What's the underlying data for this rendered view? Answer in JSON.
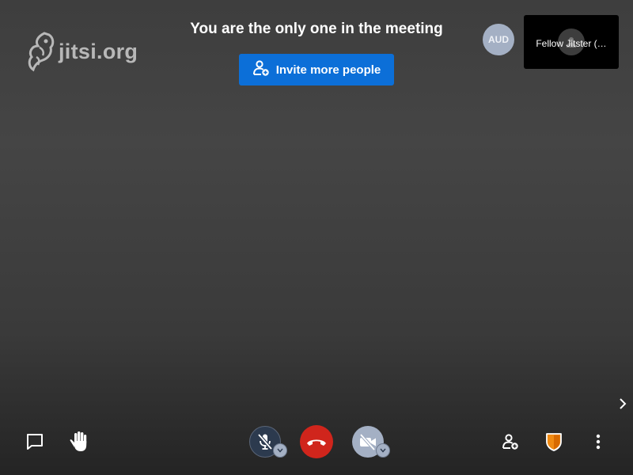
{
  "branding": {
    "logo_text": "jitsi.org",
    "logo_icon": "jitsi-logo-icon"
  },
  "notice": {
    "title": "You are the only one in the meeting",
    "invite_label": "Invite more people",
    "invite_icon": "invite-person-icon"
  },
  "participants": {
    "remote_avatar_initials": "AUD",
    "local_name": "Fellow Jitster (…"
  },
  "toolbar": {
    "left": [
      {
        "name": "chat-button",
        "icon": "chat-icon"
      },
      {
        "name": "raise-hand-button",
        "icon": "hand-icon"
      }
    ],
    "center": [
      {
        "name": "mic-button",
        "icon": "mic-muted-icon",
        "state": "muted"
      },
      {
        "name": "hangup-button",
        "icon": "phone-hangup-icon"
      },
      {
        "name": "camera-button",
        "icon": "camera-off-icon",
        "state": "off"
      }
    ],
    "right": [
      {
        "name": "invite-button",
        "icon": "invite-person-icon"
      },
      {
        "name": "security-button",
        "icon": "shield-icon"
      },
      {
        "name": "more-options-button",
        "icon": "more-vertical-icon"
      }
    ]
  },
  "colors": {
    "invite_button": "#0c6fd8",
    "hangup": "#d0251c",
    "avatar_bg": "#a4b0c4",
    "shield": "#f08a12",
    "mic_bg": "#2c3a4e"
  }
}
